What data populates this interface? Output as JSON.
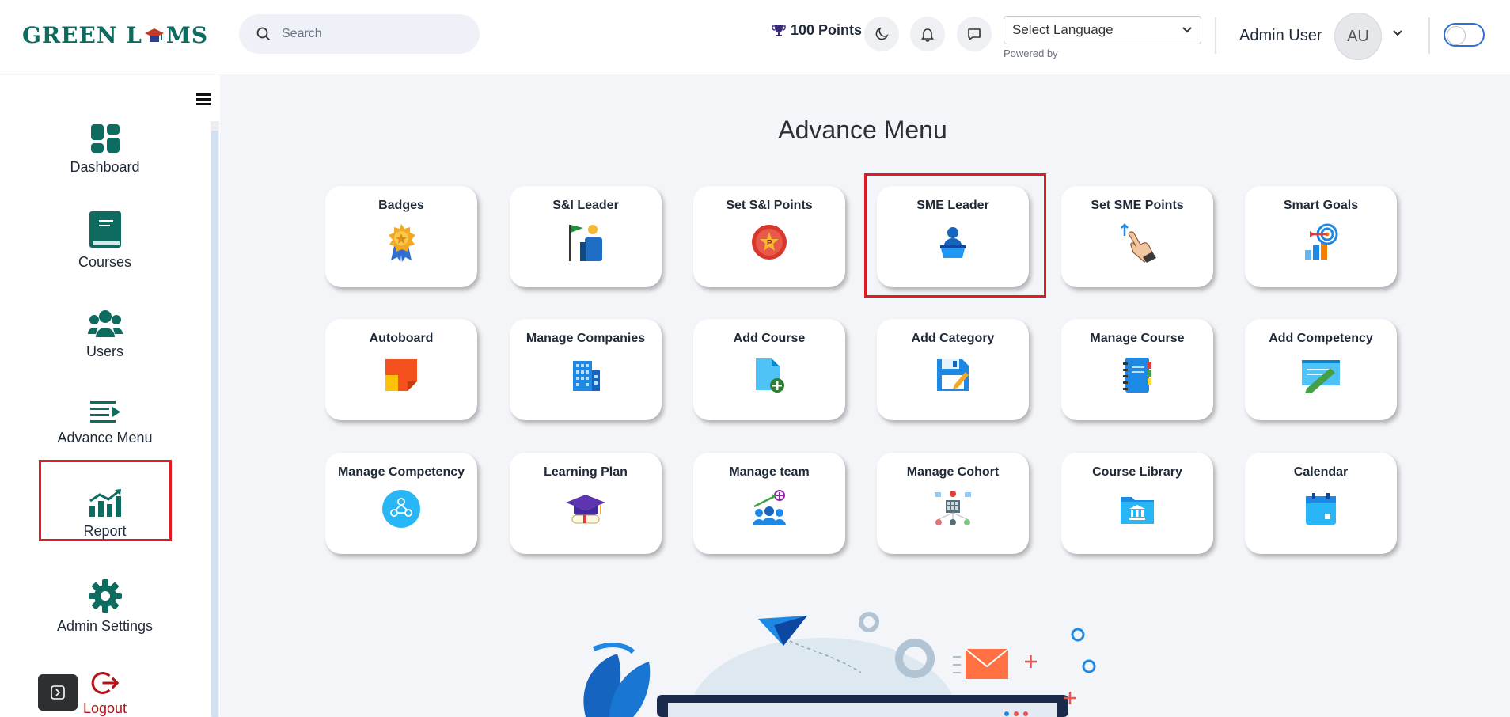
{
  "brand": {
    "logo_text_1": "GREEN L",
    "logo_text_2": "MS"
  },
  "header": {
    "search_placeholder": "Search",
    "points": "100 Points",
    "language_select": "Select Language",
    "powered_by": "Powered by",
    "user_name": "Admin User",
    "avatar_initials": "AU"
  },
  "sidebar": {
    "items": [
      {
        "label": "Dashboard",
        "icon": "dashboard-icon"
      },
      {
        "label": "Courses",
        "icon": "book-icon"
      },
      {
        "label": "Users",
        "icon": "users-icon"
      },
      {
        "label": "Advance Menu",
        "icon": "advance-menu-icon"
      },
      {
        "label": "Report",
        "icon": "report-icon"
      },
      {
        "label": "Admin Settings",
        "icon": "gear-icon"
      },
      {
        "label": "Logout",
        "icon": "logout-icon"
      }
    ]
  },
  "main": {
    "title": "Advance Menu",
    "tiles": [
      {
        "label": "Badges",
        "icon": "badge-icon"
      },
      {
        "label": "S&I Leader",
        "icon": "flag-leader-icon"
      },
      {
        "label": "Set S&I Points",
        "icon": "points-medal-icon"
      },
      {
        "label": "SME Leader",
        "icon": "sme-leader-icon"
      },
      {
        "label": "Set SME Points",
        "icon": "hand-pointer-icon"
      },
      {
        "label": "Smart Goals",
        "icon": "target-icon"
      },
      {
        "label": "Autoboard",
        "icon": "sticky-note-icon"
      },
      {
        "label": "Manage Companies",
        "icon": "building-icon"
      },
      {
        "label": "Add Course",
        "icon": "add-file-icon"
      },
      {
        "label": "Add Category",
        "icon": "floppy-disk-icon"
      },
      {
        "label": "Manage Course",
        "icon": "notebook-icon"
      },
      {
        "label": "Add Competency",
        "icon": "pen-paper-icon"
      },
      {
        "label": "Manage Competency",
        "icon": "competency-network-icon"
      },
      {
        "label": "Learning Plan",
        "icon": "graduation-cap-icon"
      },
      {
        "label": "Manage team",
        "icon": "team-growth-icon"
      },
      {
        "label": "Manage Cohort",
        "icon": "cohort-board-icon"
      },
      {
        "label": "Course Library",
        "icon": "library-folder-icon"
      },
      {
        "label": "Calendar",
        "icon": "calendar-icon"
      }
    ]
  },
  "colors": {
    "brand_green": "#0d6b5f",
    "highlight_red": "#e01b24",
    "page_bg": "#f4f5f9"
  }
}
